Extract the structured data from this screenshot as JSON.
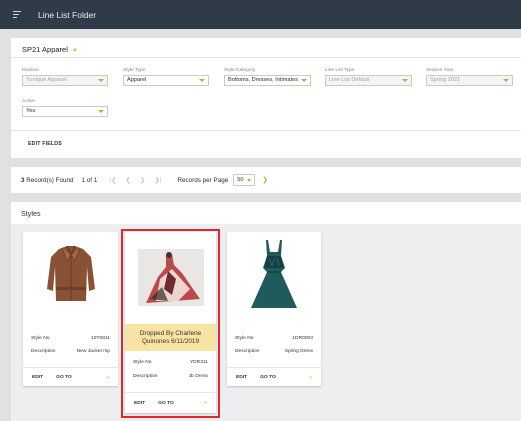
{
  "header": {
    "title": "Line List Folder",
    "menu_icon": "hamburger-icon"
  },
  "filters": {
    "folder_name": "SP21 Apparel",
    "fields": [
      {
        "label": "Division",
        "value": "Yunique Apparel",
        "disabled": true
      },
      {
        "label": "Style Type",
        "value": "Apparel",
        "disabled": false
      },
      {
        "label": "Style Category",
        "value": "Bottoms, Dresses, Intimates",
        "disabled": false
      },
      {
        "label": "Line List Type",
        "value": "Line List Default",
        "disabled": true
      },
      {
        "label": "Season Year",
        "value": "Spring 2021",
        "disabled": true
      },
      {
        "label": "Active",
        "value": "Yes",
        "disabled": false
      }
    ],
    "edit_fields_label": "EDIT FIELDS"
  },
  "pager": {
    "record_count": "3",
    "records_found_label": "Record(s) Found",
    "page_info": "1 of 1",
    "records_per_page_label": "Records per Page",
    "records_per_page_value": "50"
  },
  "styles": {
    "title": "Styles",
    "cards": [
      {
        "style_no_label": "Style No",
        "style_no": "10T0811",
        "description_label": "Description",
        "description": "New Jacket mp",
        "edit_label": "EDIT",
        "goto_label": "GO TO",
        "notice": ""
      },
      {
        "style_no_label": "Style No",
        "style_no": "YDR311",
        "description_label": "Description",
        "description": "Jb Dress",
        "edit_label": "EDIT",
        "goto_label": "GO TO",
        "notice_line1": "Dropped By Charlene",
        "notice_line2": "Quinones 6/11/2019"
      },
      {
        "style_no_label": "Style No",
        "style_no": "1DR0003",
        "description_label": "Description",
        "description": "Spring Dress",
        "edit_label": "EDIT",
        "goto_label": "GO TO",
        "notice": ""
      }
    ]
  },
  "colors": {
    "accent": "#9abe36",
    "topbar": "#2f3b47",
    "highlight": "#e1262c",
    "notice_bg": "#f9e3a3"
  }
}
